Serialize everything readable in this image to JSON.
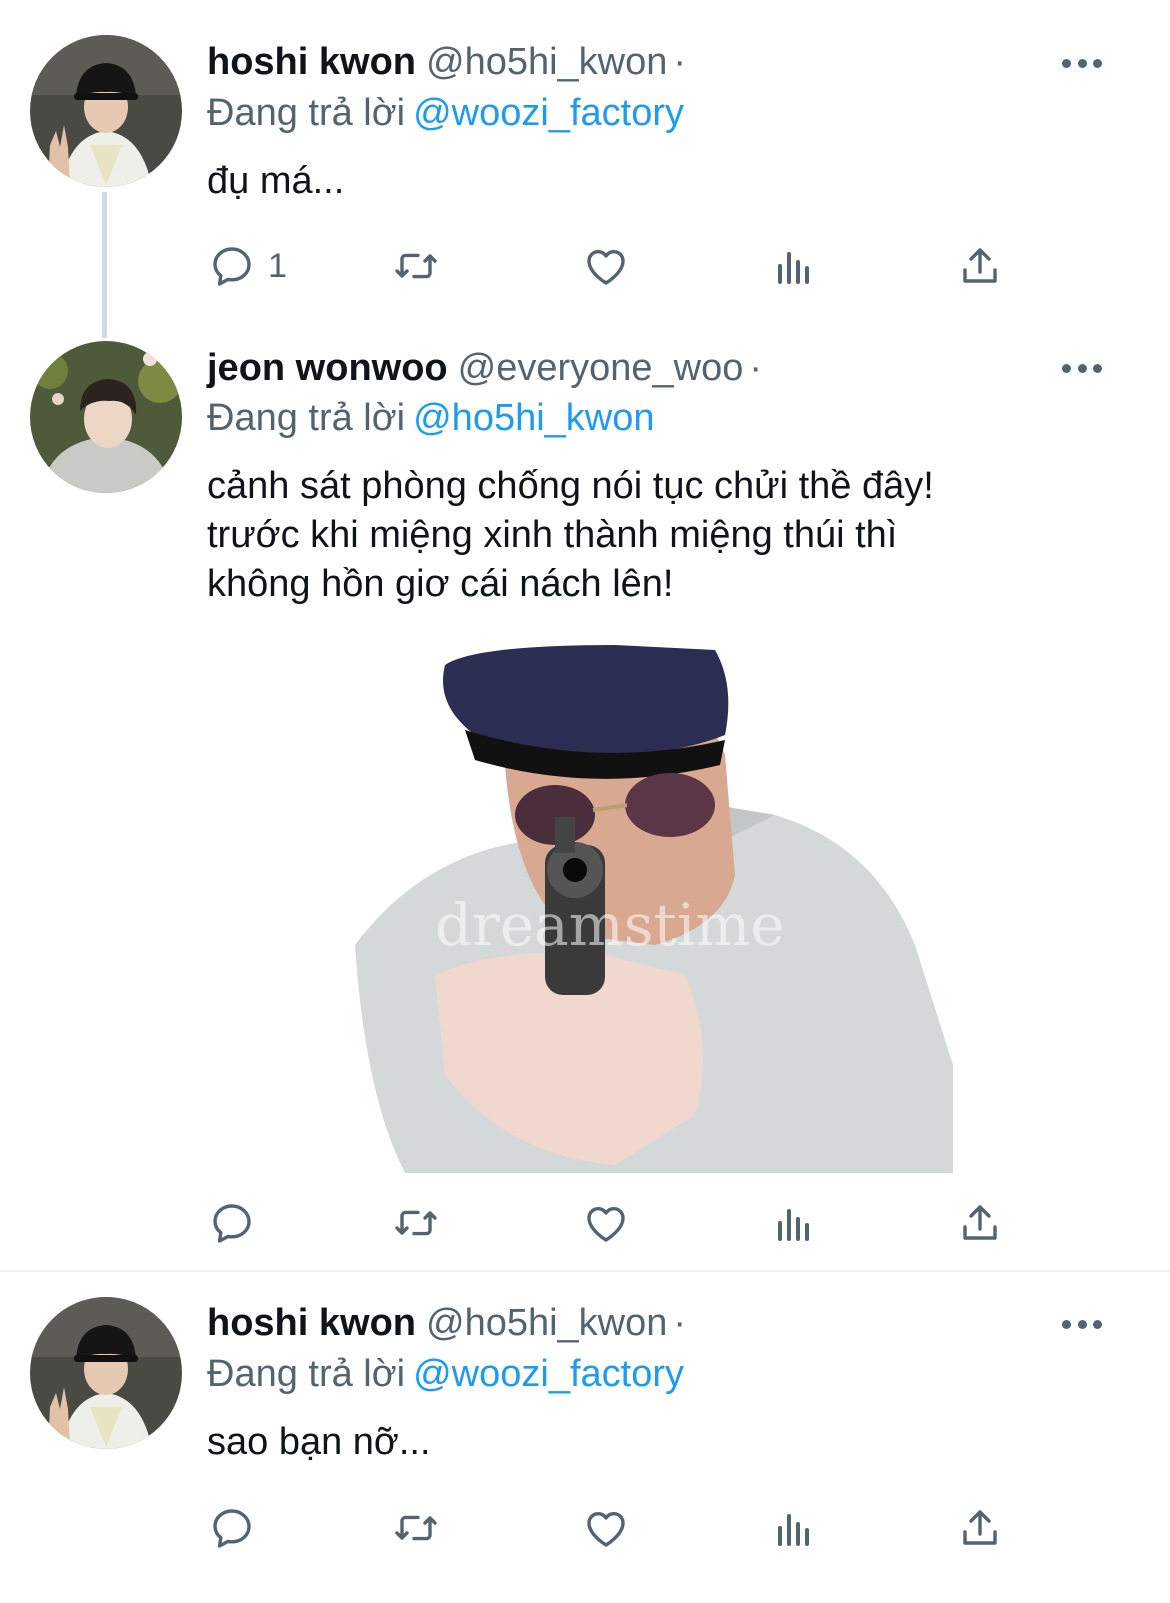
{
  "tweets": [
    {
      "display_name": "hoshi kwon",
      "handle": "@ho5hi_kwon",
      "separator": "·",
      "reply_prefix": "Đang trả lời",
      "reply_to": "@woozi_factory",
      "text": "đụ má...",
      "reply_count": "1",
      "avatar": "person-bucket-hat-peace-sign"
    },
    {
      "display_name": "jeon wonwoo",
      "handle": "@everyone_woo",
      "separator": "·",
      "reply_prefix": "Đang trả lời",
      "reply_to": "@ho5hi_kwon",
      "text": "cảnh sát phòng chống nói tục chửi thề đây!\ntrước khi miệng xinh thành miệng thúi thì\nkhông hồn giơ cái nách lên!",
      "reply_count": "",
      "avatar": "person-grey-jacket-flowers",
      "media": "police-officer-aiming-revolver-photo",
      "media_watermark": "dreamstime"
    },
    {
      "display_name": "hoshi kwon",
      "handle": "@ho5hi_kwon",
      "separator": "·",
      "reply_prefix": "Đang trả lời",
      "reply_to": "@woozi_factory",
      "text": "sao bạn nỡ...",
      "reply_count": "",
      "avatar": "person-bucket-hat-peace-sign"
    }
  ],
  "icons": {
    "reply": "speech-bubble-icon",
    "retweet": "retweet-arrows-icon",
    "like": "heart-icon",
    "views": "bar-chart-icon",
    "share": "share-upload-icon",
    "more": "three-dots-icon"
  },
  "colors": {
    "link": "#1d9bf0",
    "secondary_text": "#536471",
    "primary_text": "#0f1419",
    "thread_line": "#cfd9de"
  }
}
